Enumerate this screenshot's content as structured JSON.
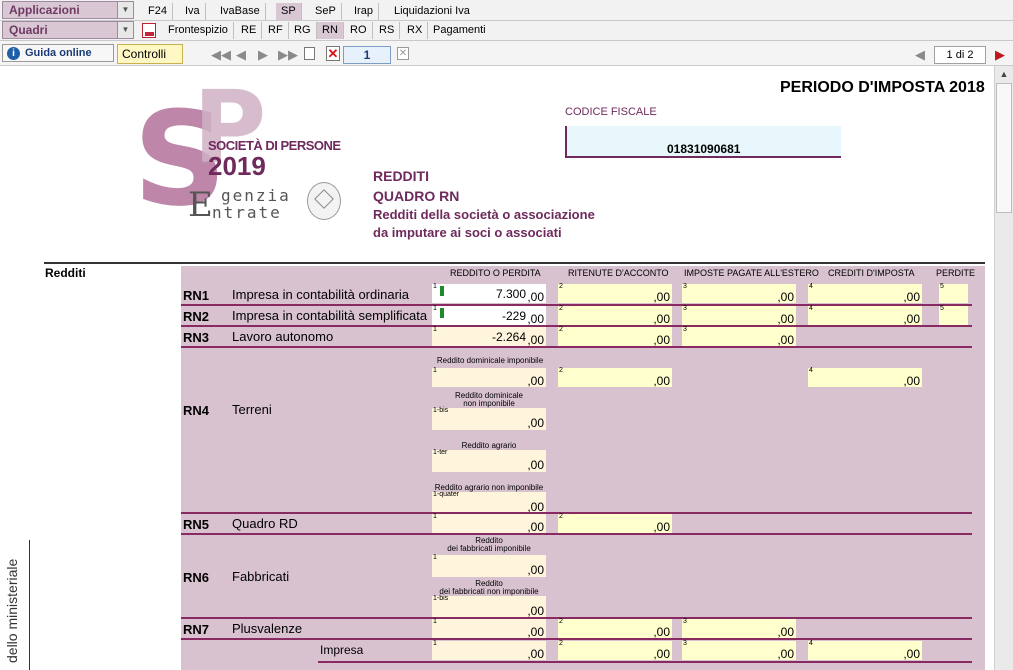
{
  "toolbar": {
    "applicazioni": "Applicazioni",
    "quadri": "Quadri",
    "app_tabs": [
      {
        "label": "F24"
      },
      {
        "label": "Iva"
      },
      {
        "label": "IvaBase"
      },
      {
        "label": "SP"
      },
      {
        "label": "SeP"
      },
      {
        "label": "Irap"
      },
      {
        "label": "Liquidazioni Iva"
      }
    ],
    "quadri_tabs": [
      {
        "label": "Frontespizio"
      },
      {
        "label": "RE"
      },
      {
        "label": "RF"
      },
      {
        "label": "RG"
      },
      {
        "label": "RN"
      },
      {
        "label": "RO"
      },
      {
        "label": "RS"
      },
      {
        "label": "RX"
      },
      {
        "label": "Pagamenti"
      }
    ],
    "guida_online": "Guida online",
    "guida_icon": "info-icon",
    "controlli": "Controlli",
    "page_current": "1",
    "pagination": "1 di 2"
  },
  "header": {
    "periodo": "PERIODO D'IMPOSTA 2018",
    "codice_fiscale_label": "CODICE FISCALE",
    "codice_fiscale": "01831090681",
    "logo_big": "SP",
    "logo_line1": "SOCIETÀ DI PERSONE",
    "logo_year": "2019",
    "agenzia_line1": "genzia",
    "agenzia_line2": "ntrate",
    "title1": "REDDITI",
    "title2": "QUADRO RN",
    "subtitle1": "Redditi della società o associazione",
    "subtitle2": "da imputare ai soci o associati"
  },
  "side": {
    "section": "Redditi",
    "vertical": "dello ministeriale"
  },
  "columns": {
    "c1": "REDDITO O PERDITA",
    "c2": "RITENUTE D'ACCONTO",
    "c3": "IMPOSTE PAGATE ALL'ESTERO",
    "c4": "CREDITI D'IMPOSTA",
    "c5": "PERDITE"
  },
  "rows": {
    "rn1": {
      "code": "RN1",
      "label": "Impresa in contabilità ordinaria",
      "v1": "7.300"
    },
    "rn2": {
      "code": "RN2",
      "label": "Impresa in contabilità semplificata",
      "v1": "-229"
    },
    "rn3": {
      "code": "RN3",
      "label": "Lavoro autonomo",
      "v1": "-2.264"
    },
    "rn4": {
      "code": "RN4",
      "label": "Terreni",
      "cap1": "Reddito dominicale imponibile",
      "cap1b_a": "Reddito dominicale",
      "cap1b_b": "non imponibile",
      "cap1t": "Reddito agrario",
      "cap1q": "Reddito agrario non imponibile"
    },
    "rn5": {
      "code": "RN5",
      "label": "Quadro RD"
    },
    "rn6": {
      "code": "RN6",
      "label": "Fabbricati",
      "cap_a1": "Reddito",
      "cap_a2": "dei fabbricati imponibile",
      "cap_b1": "Reddito",
      "cap_b2": "dei fabbricati non imponibile"
    },
    "rn7": {
      "code": "RN7",
      "label": "Plusvalenze",
      "sub": "Impresa"
    }
  },
  "nums": {
    "n1": "1",
    "n2": "2",
    "n3": "3",
    "n4": "4",
    "n5": "5",
    "n1bis": "1-bis",
    "n1ter": "1-ter",
    "n1quater": "1-quater",
    "cents": ",00"
  },
  "colors": {
    "accent": "#8a2a62",
    "form_bg": "#d9c2d0",
    "field_peach": "#fff4dc",
    "field_yellow": "#ffffce"
  }
}
